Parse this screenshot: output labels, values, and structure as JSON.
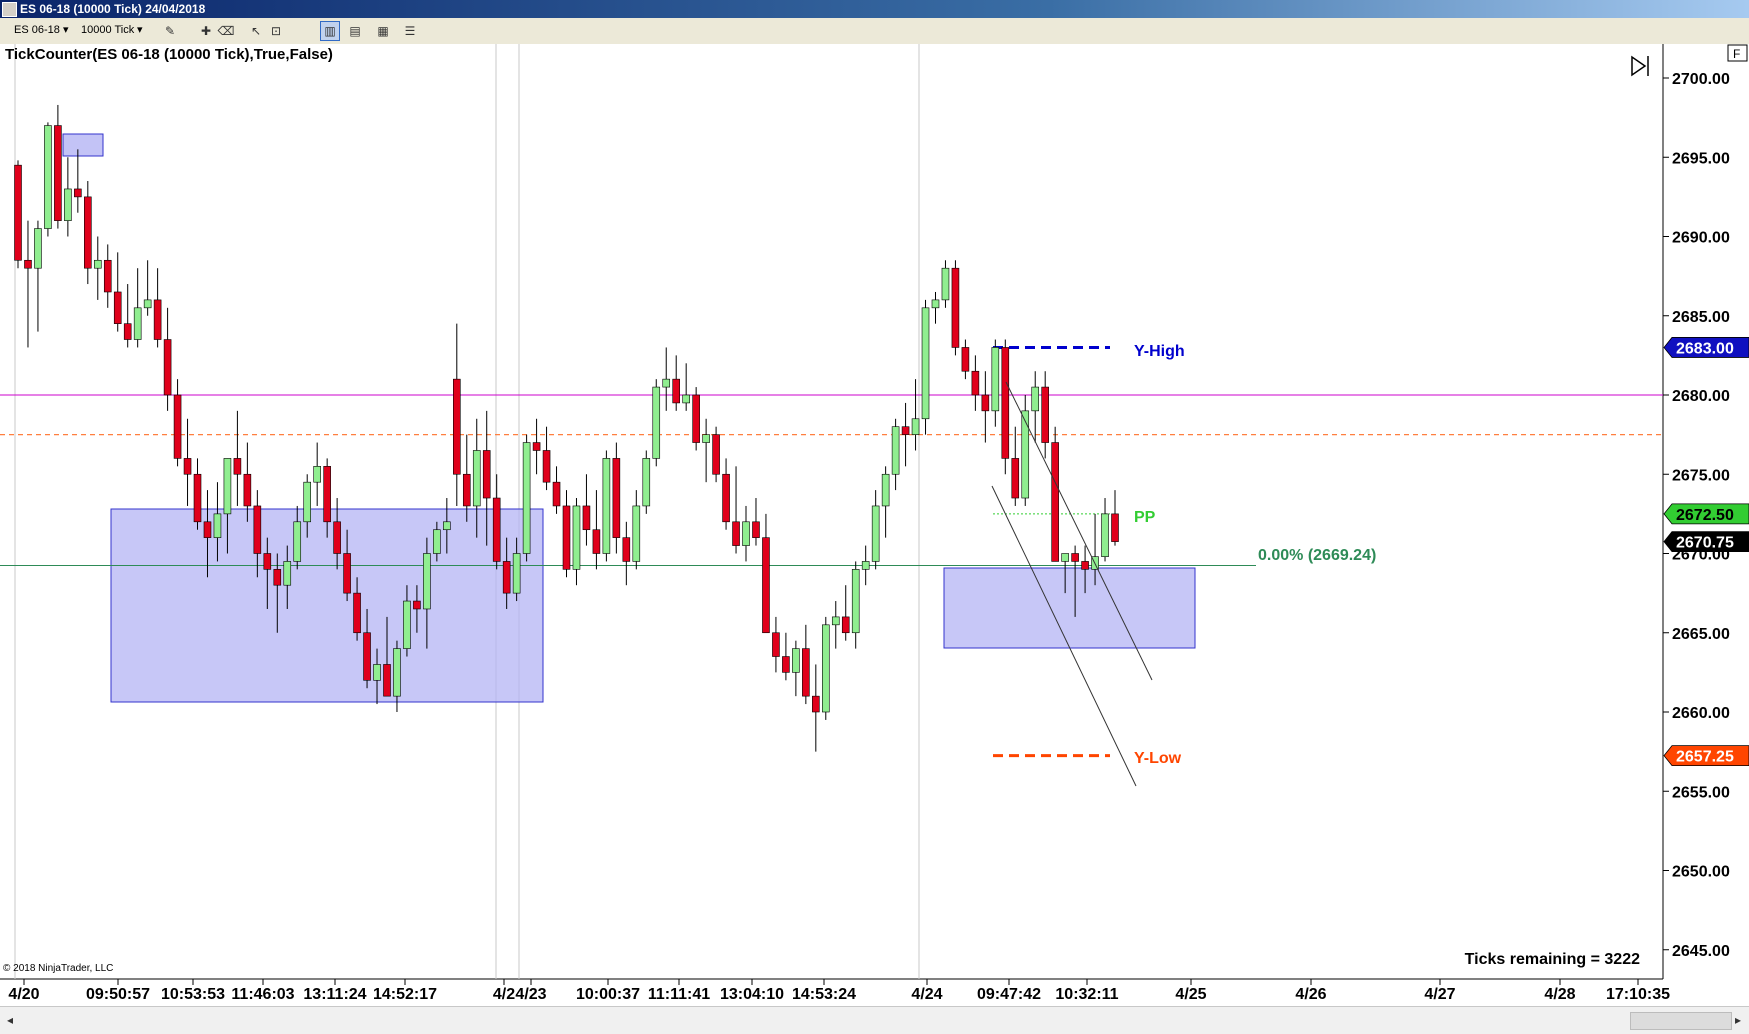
{
  "window": {
    "title": "ES 06-18 (10000 Tick)  24/04/2018"
  },
  "toolbar": {
    "instrument": "ES 06-18",
    "interval": "10000 Tick",
    "buttons": [
      "pencil-icon",
      "add-icon",
      "eraser-icon",
      "cursor-icon",
      "zoom-icon",
      "bar-chart-icon",
      "candle-icon",
      "line-icon",
      "properties-icon"
    ]
  },
  "chart": {
    "indicator_label": "TickCounter(ES 06-18 (10000 Tick),True,False)",
    "copyright": "© 2018 NinjaTrader, LLC",
    "ticks_remaining": "Ticks remaining = 3222",
    "fib_label": "0.00% (2669.24)",
    "yhigh_label": "Y-High",
    "ylow_label": "Y-Low",
    "pp_label": "PP",
    "price_scale": [
      "2700.00",
      "2695.00",
      "2690.00",
      "2685.00",
      "2680.00",
      "2675.00",
      "2670.00",
      "2665.00",
      "2660.00",
      "2655.00",
      "2650.00",
      "2645.00"
    ],
    "badges": {
      "yhigh": "2683.00",
      "pp": "2672.50",
      "last": "2670.75",
      "ylow": "2657.25"
    },
    "time_axis": [
      "4/20",
      "09:50:57",
      "10:53:53",
      "11:46:03",
      "13:11:24",
      "14:52:17",
      "4/2",
      "4/23",
      "10:00:37",
      "11:11:41",
      "13:04:10",
      "14:53:24",
      "4/24",
      "09:47:42",
      "10:32:11",
      "4/25",
      "4/26",
      "4/27",
      "4/28",
      "17:10:35"
    ],
    "colors": {
      "up": "#90ee90",
      "down": "#e0001b",
      "rect": "#b4b4f4",
      "yhigh": "#0000cd",
      "ylow": "#ff4500",
      "pp": "#32cd32",
      "magenta": "#cc00cc",
      "orange": "#ff7f3f",
      "green": "#2e8b57"
    }
  },
  "chart_data": {
    "type": "candlestick",
    "ylim": [
      2643,
      2702
    ],
    "levels": {
      "yhigh": 2683.0,
      "pp": 2672.5,
      "ylow": 2657.25,
      "fib": 2669.24,
      "magenta": 2680.0,
      "orange": 2677.5,
      "last": 2670.75
    },
    "candles": [
      [
        2694.5,
        2694.8,
        2688.0,
        2688.5
      ],
      [
        2688.5,
        2691.0,
        2683.0,
        2688.0
      ],
      [
        2688.0,
        2691.0,
        2684.0,
        2690.5
      ],
      [
        2690.5,
        2697.2,
        2690.0,
        2697.0
      ],
      [
        2697.0,
        2698.3,
        2690.5,
        2691.0
      ],
      [
        2691.0,
        2695.0,
        2690.0,
        2693.0
      ],
      [
        2693.0,
        2695.5,
        2691.5,
        2692.5
      ],
      [
        2692.5,
        2693.5,
        2687.0,
        2688.0
      ],
      [
        2688.0,
        2690.0,
        2686.0,
        2688.5
      ],
      [
        2688.5,
        2689.5,
        2685.5,
        2686.5
      ],
      [
        2686.5,
        2689.0,
        2684.0,
        2684.5
      ],
      [
        2684.5,
        2687.0,
        2683.0,
        2683.5
      ],
      [
        2683.5,
        2688.0,
        2683.0,
        2685.5
      ],
      [
        2685.5,
        2688.5,
        2685.0,
        2686.0
      ],
      [
        2686.0,
        2688.0,
        2683.0,
        2683.5
      ],
      [
        2683.5,
        2685.5,
        2679.0,
        2680.0
      ],
      [
        2680.0,
        2681.0,
        2675.5,
        2676.0
      ],
      [
        2676.0,
        2678.5,
        2673.0,
        2675.0
      ],
      [
        2675.0,
        2676.0,
        2671.5,
        2672.0
      ],
      [
        2672.0,
        2674.0,
        2668.5,
        2671.0
      ],
      [
        2671.0,
        2674.5,
        2669.5,
        2672.5
      ],
      [
        2672.5,
        2676.0,
        2670.0,
        2676.0
      ],
      [
        2676.0,
        2679.0,
        2673.0,
        2675.0
      ],
      [
        2675.0,
        2677.0,
        2672.0,
        2673.0
      ],
      [
        2673.0,
        2674.0,
        2668.5,
        2670.0
      ],
      [
        2670.0,
        2671.0,
        2666.5,
        2669.0
      ],
      [
        2669.0,
        2670.0,
        2665.0,
        2668.0
      ],
      [
        2668.0,
        2670.5,
        2666.5,
        2669.5
      ],
      [
        2669.5,
        2673.0,
        2669.0,
        2672.0
      ],
      [
        2672.0,
        2675.0,
        2671.0,
        2674.5
      ],
      [
        2674.5,
        2677.0,
        2673.0,
        2675.5
      ],
      [
        2675.5,
        2676.0,
        2671.0,
        2672.0
      ],
      [
        2672.0,
        2673.5,
        2669.0,
        2670.0
      ],
      [
        2670.0,
        2671.5,
        2667.0,
        2667.5
      ],
      [
        2667.5,
        2668.5,
        2664.5,
        2665.0
      ],
      [
        2665.0,
        2666.5,
        2661.5,
        2662.0
      ],
      [
        2662.0,
        2664.0,
        2660.5,
        2663.0
      ],
      [
        2663.0,
        2666.0,
        2662.0,
        2661.0
      ],
      [
        2661.0,
        2664.5,
        2660.0,
        2664.0
      ],
      [
        2664.0,
        2668.0,
        2663.5,
        2667.0
      ],
      [
        2667.0,
        2668.0,
        2665.0,
        2666.5
      ],
      [
        2666.5,
        2671.0,
        2664.0,
        2670.0
      ],
      [
        2670.0,
        2672.0,
        2669.5,
        2671.5
      ],
      [
        2671.5,
        2673.5,
        2670.0,
        2672.0
      ],
      [
        2681.0,
        2684.5,
        2673.0,
        2675.0
      ],
      [
        2675.0,
        2677.5,
        2672.0,
        2673.0
      ],
      [
        2673.0,
        2678.5,
        2671.0,
        2676.5
      ],
      [
        2676.5,
        2679.0,
        2670.5,
        2673.5
      ],
      [
        2673.5,
        2675.0,
        2669.0,
        2669.5
      ],
      [
        2669.5,
        2671.0,
        2666.5,
        2667.5
      ],
      [
        2667.5,
        2671.0,
        2667.0,
        2670.0
      ],
      [
        2670.0,
        2677.5,
        2669.5,
        2677.0
      ],
      [
        2677.0,
        2678.5,
        2675.0,
        2676.5
      ],
      [
        2676.5,
        2678.0,
        2674.0,
        2674.5
      ],
      [
        2674.5,
        2675.5,
        2672.5,
        2673.0
      ],
      [
        2673.0,
        2674.0,
        2668.5,
        2669.0
      ],
      [
        2669.0,
        2673.5,
        2668.0,
        2673.0
      ],
      [
        2673.0,
        2675.0,
        2670.5,
        2671.5
      ],
      [
        2671.5,
        2674.0,
        2669.0,
        2670.0
      ],
      [
        2670.0,
        2676.5,
        2669.5,
        2676.0
      ],
      [
        2676.0,
        2677.0,
        2670.0,
        2671.0
      ],
      [
        2671.0,
        2672.0,
        2668.0,
        2669.5
      ],
      [
        2669.5,
        2674.0,
        2669.0,
        2673.0
      ],
      [
        2673.0,
        2676.5,
        2672.5,
        2676.0
      ],
      [
        2676.0,
        2681.0,
        2675.5,
        2680.5
      ],
      [
        2680.5,
        2683.0,
        2679.0,
        2681.0
      ],
      [
        2681.0,
        2682.5,
        2679.0,
        2679.5
      ],
      [
        2679.5,
        2682.0,
        2679.0,
        2680.0
      ],
      [
        2680.0,
        2680.5,
        2676.5,
        2677.0
      ],
      [
        2677.0,
        2678.5,
        2674.5,
        2677.5
      ],
      [
        2677.5,
        2678.0,
        2674.5,
        2675.0
      ],
      [
        2675.0,
        2676.0,
        2671.5,
        2672.0
      ],
      [
        2672.0,
        2675.5,
        2670.0,
        2670.5
      ],
      [
        2670.5,
        2673.0,
        2669.5,
        2672.0
      ],
      [
        2672.0,
        2673.5,
        2670.5,
        2671.0
      ],
      [
        2671.0,
        2672.5,
        2666.0,
        2665.0
      ],
      [
        2665.0,
        2666.0,
        2662.5,
        2663.5
      ],
      [
        2663.5,
        2665.0,
        2662.0,
        2662.5
      ],
      [
        2662.5,
        2664.5,
        2661.0,
        2664.0
      ],
      [
        2664.0,
        2665.5,
        2660.5,
        2661.0
      ],
      [
        2661.0,
        2663.0,
        2657.5,
        2660.0
      ],
      [
        2660.0,
        2666.0,
        2659.5,
        2665.5
      ],
      [
        2665.5,
        2667.0,
        2664.0,
        2666.0
      ],
      [
        2666.0,
        2668.0,
        2664.5,
        2665.0
      ],
      [
        2665.0,
        2669.5,
        2664.0,
        2669.0
      ],
      [
        2669.0,
        2670.5,
        2668.0,
        2669.5
      ],
      [
        2669.5,
        2674.0,
        2669.0,
        2673.0
      ],
      [
        2673.0,
        2675.5,
        2671.0,
        2675.0
      ],
      [
        2675.0,
        2678.5,
        2674.0,
        2678.0
      ],
      [
        2678.0,
        2679.5,
        2675.5,
        2677.5
      ],
      [
        2677.5,
        2681.0,
        2676.5,
        2678.5
      ],
      [
        2678.5,
        2686.0,
        2677.5,
        2685.5
      ],
      [
        2685.5,
        2686.5,
        2684.5,
        2686.0
      ],
      [
        2686.0,
        2688.5,
        2685.5,
        2688.0
      ],
      [
        2688.0,
        2688.5,
        2682.5,
        2683.0
      ],
      [
        2683.0,
        2683.5,
        2681.0,
        2681.5
      ],
      [
        2681.5,
        2682.5,
        2679.0,
        2680.0
      ],
      [
        2680.0,
        2681.5,
        2677.0,
        2679.0
      ],
      [
        2679.0,
        2683.5,
        2678.0,
        2683.0
      ],
      [
        2683.0,
        2683.5,
        2675.0,
        2676.0
      ],
      [
        2676.0,
        2678.0,
        2673.0,
        2673.5
      ],
      [
        2673.5,
        2680.0,
        2673.0,
        2679.0
      ],
      [
        2679.0,
        2681.5,
        2677.0,
        2680.5
      ],
      [
        2680.5,
        2681.5,
        2676.0,
        2677.0
      ],
      [
        2677.0,
        2678.0,
        2669.5,
        2669.5
      ],
      [
        2669.5,
        2670.0,
        2667.5,
        2670.0
      ],
      [
        2670.0,
        2670.5,
        2666.0,
        2669.5
      ],
      [
        2669.5,
        2670.5,
        2667.5,
        2669.0
      ],
      [
        2669.0,
        2672.5,
        2668.0,
        2669.8
      ],
      [
        2669.8,
        2673.5,
        2669.5,
        2672.5
      ],
      [
        2672.5,
        2674.0,
        2670.5,
        2670.75
      ]
    ]
  }
}
